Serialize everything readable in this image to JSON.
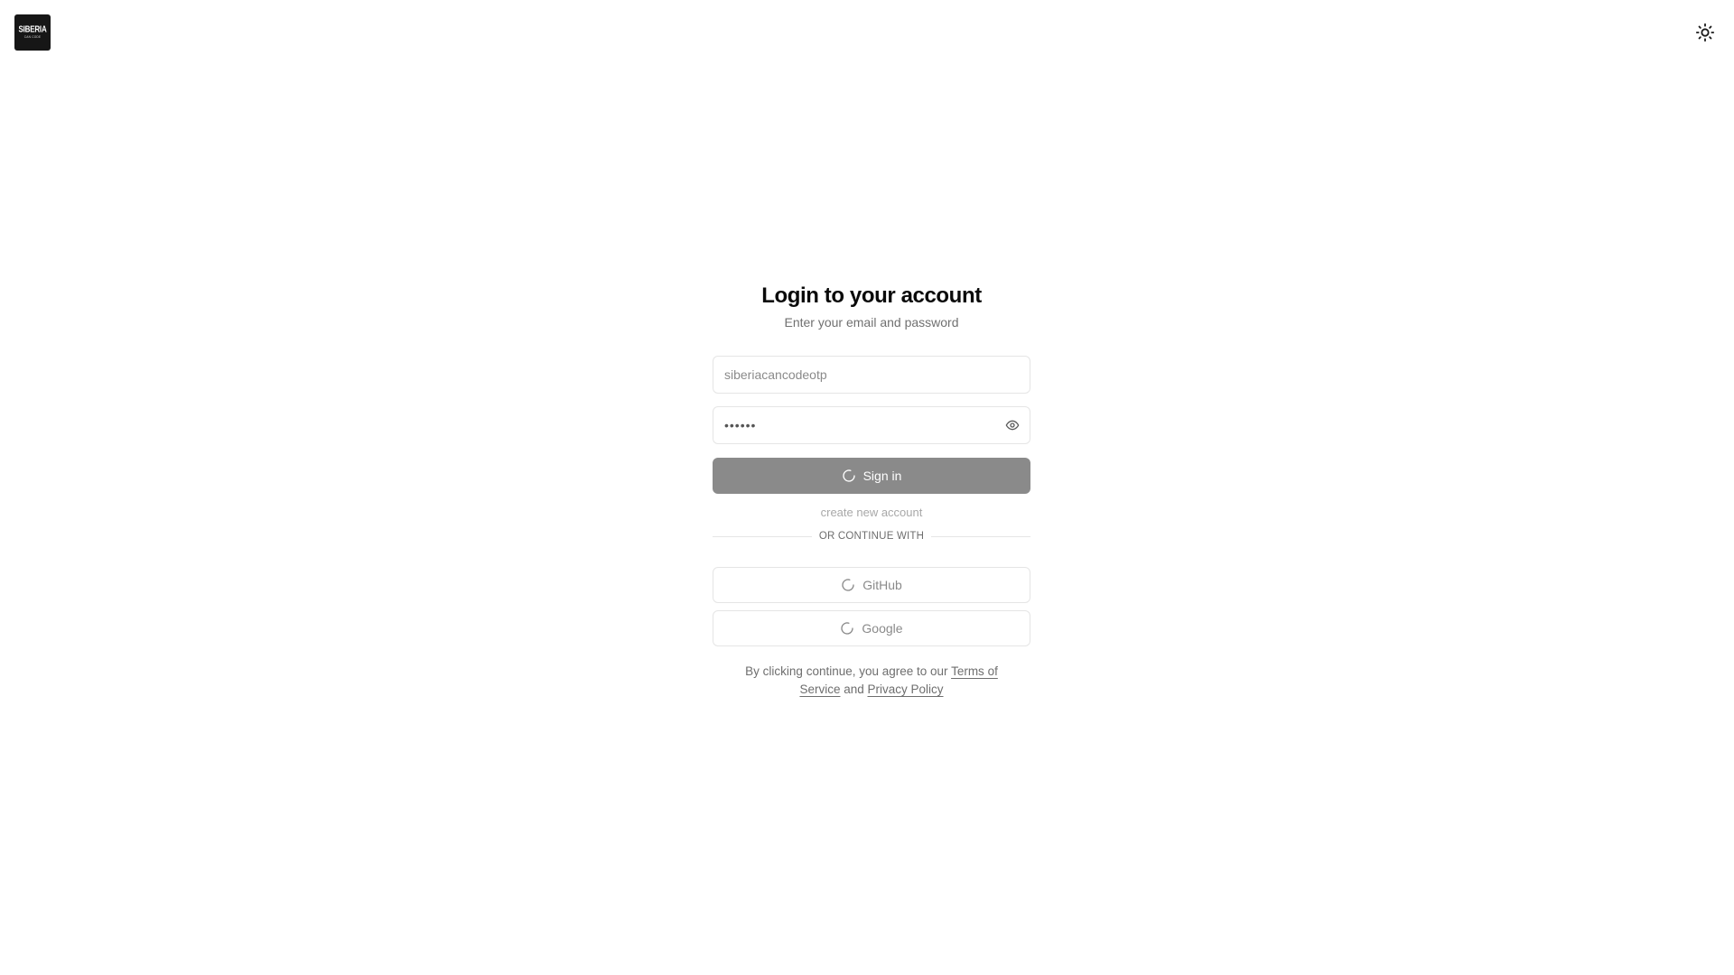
{
  "app": {
    "logo_line1": "SIBERIA",
    "logo_line2": "CAN CODE"
  },
  "header": {
    "theme_toggle_icon": "sun-icon"
  },
  "login": {
    "title": "Login to your account",
    "subtitle": "Enter your email and password",
    "email_value": "siberiacancodeotp",
    "password_masked": "••••••",
    "password_toggle_icon": "eye-icon",
    "sign_in_label": "Sign in",
    "sign_in_state": "loading",
    "create_account_label": "create new account",
    "divider_label": "OR CONTINUE WITH",
    "github_label": "GitHub",
    "google_label": "Google",
    "spinner_icon": "spinner-icon"
  },
  "terms": {
    "prefix": "By clicking continue, you agree to our ",
    "tos_label": "Terms of Service",
    "and": " and ",
    "privacy_label": "Privacy Policy"
  },
  "colors": {
    "primary_disabled": "#8a8a8a",
    "border": "#e5e5e5",
    "muted_text": "#707070",
    "logo_bg": "#161616"
  }
}
